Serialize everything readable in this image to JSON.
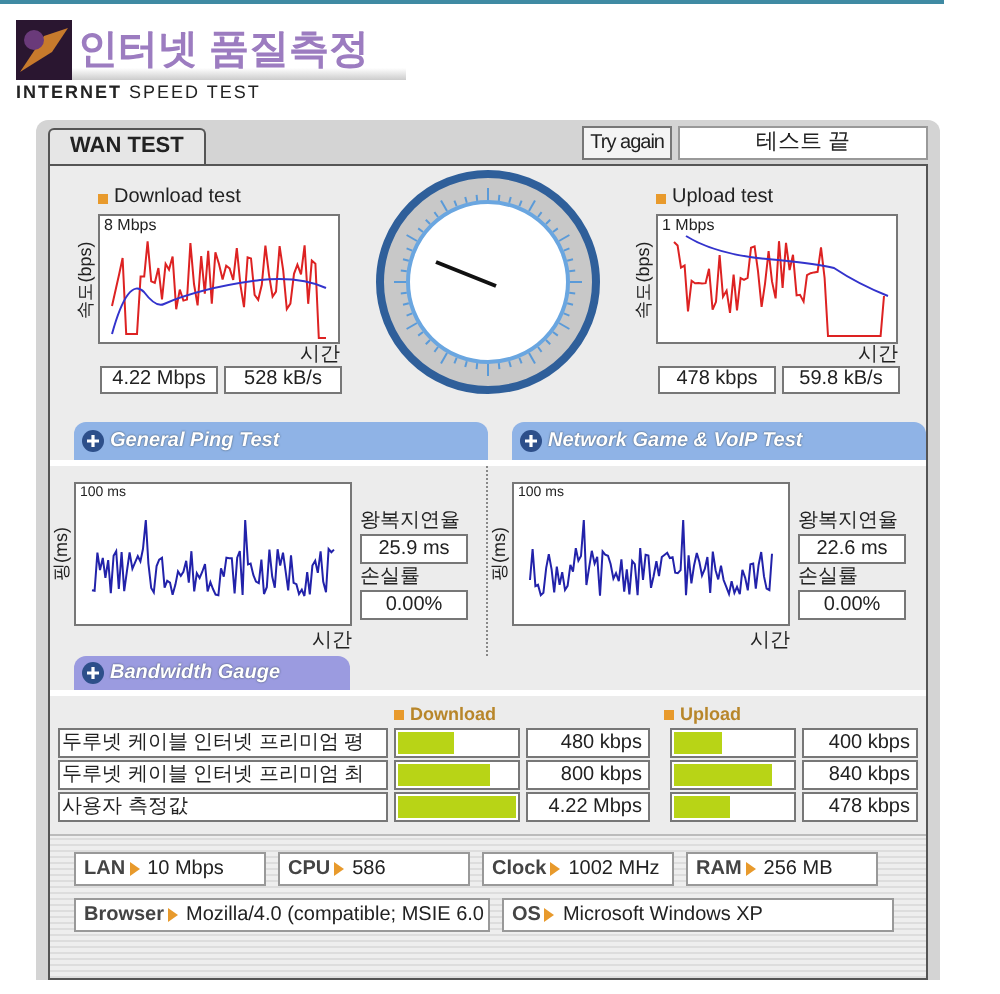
{
  "header": {
    "title": "인터넷 품질측정",
    "subtitle_bold": "INTERNET",
    "subtitle": "SPEED TEST"
  },
  "tabs": [
    {
      "label": "WAN TEST",
      "selected": true
    }
  ],
  "try_again": "Try again",
  "status": "테스트 끝",
  "speed_tests": [
    {
      "title": "Download test",
      "axis_label": "속도(bps)",
      "scale": "8 Mbps",
      "time_label": "시간",
      "readings": [
        "4.22 Mbps",
        "528 kB/s"
      ]
    },
    {
      "title": "Upload test",
      "axis_label": "속도(bps)",
      "scale": "1 Mbps",
      "time_label": "시간",
      "readings": [
        "478 kbps",
        "59.8 kB/s"
      ]
    }
  ],
  "ping_tests": [
    {
      "title": "General Ping Test",
      "axis_label": "핑(ms)",
      "scale": "100 ms",
      "time_label": "시간",
      "latency_label": "왕복지연율",
      "latency": "25.9 ms",
      "loss_label": "손실률",
      "loss": "0.00%"
    },
    {
      "title": "Network Game & VoIP Test",
      "axis_label": "핑(ms)",
      "scale": "100 ms",
      "time_label": "시간",
      "latency_label": "왕복지연율",
      "latency": "22.6 ms",
      "loss_label": "손실률",
      "loss": "0.00%"
    }
  ],
  "bandwidth": {
    "title": "Bandwidth Gauge",
    "download_label": "Download",
    "upload_label": "Upload",
    "rows": [
      {
        "name": "두루넷 케이블 인터넷 프리미엄 평",
        "download": {
          "level": 0.47,
          "value": "480 kbps"
        },
        "upload": {
          "level": 0.4,
          "value": "400 kbps"
        }
      },
      {
        "name": "두루넷 케이블 인터넷 프리미엄 최",
        "download": {
          "level": 0.78,
          "value": "800 kbps"
        },
        "upload": {
          "level": 0.83,
          "value": "840 kbps"
        }
      },
      {
        "name": "사용자 측정값",
        "download": {
          "level": 1.0,
          "value": "4.22 Mbps"
        },
        "upload": {
          "level": 0.47,
          "value": "478 kbps"
        }
      }
    ]
  },
  "system_info": [
    [
      {
        "label": "LAN",
        "value": "10 Mbps"
      },
      {
        "label": "CPU",
        "value": "586"
      },
      {
        "label": "Clock",
        "value": "1002 MHz"
      },
      {
        "label": "RAM",
        "value": "256 MB"
      }
    ],
    [
      {
        "label": "Browser",
        "value": "Mozilla/4.0 (compatible; MSIE 6.0"
      },
      {
        "label": "OS",
        "value": "Microsoft Windows XP"
      }
    ]
  ]
}
